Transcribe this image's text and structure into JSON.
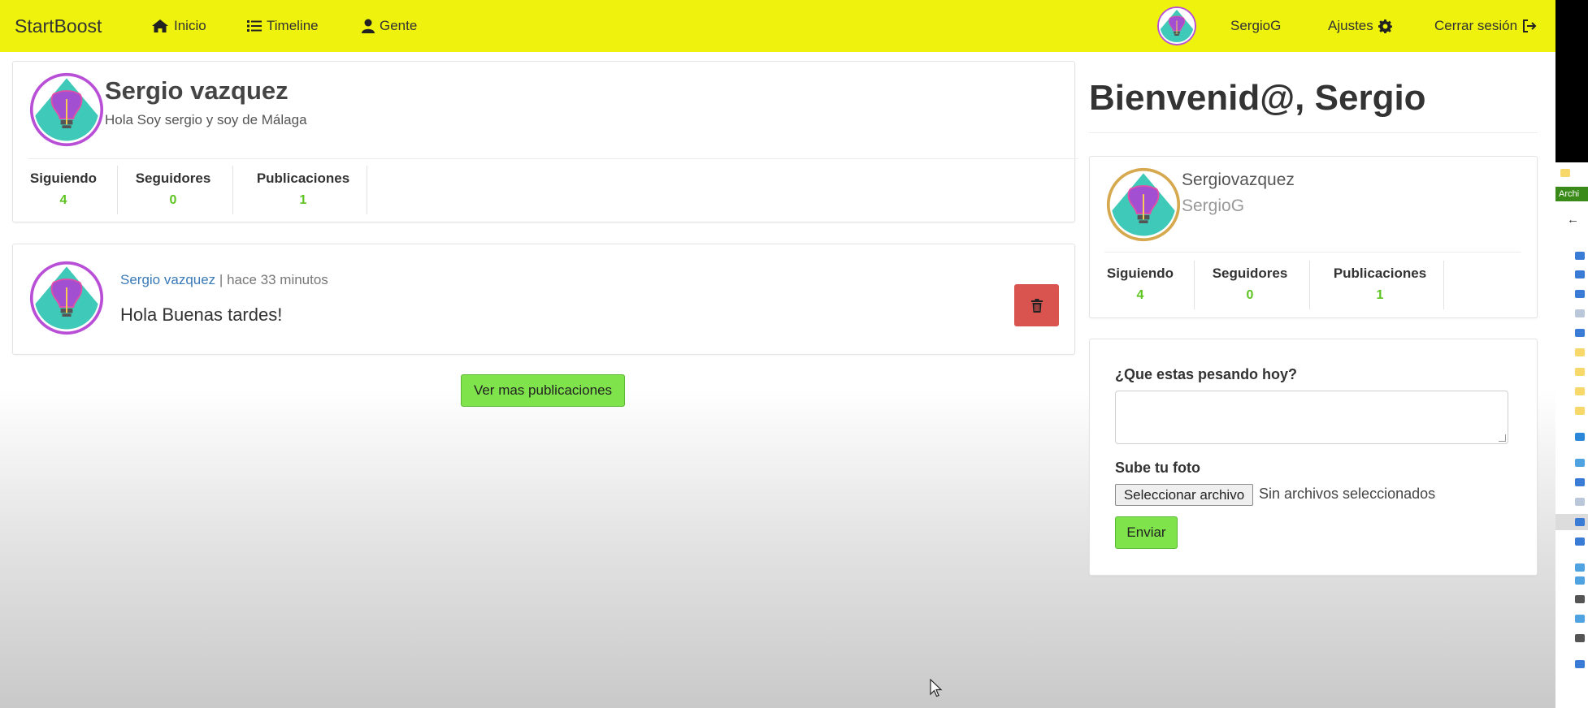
{
  "navbar": {
    "brand": "StartBoost",
    "items": [
      {
        "label": "Inicio",
        "icon": "home-icon"
      },
      {
        "label": "Timeline",
        "icon": "list-icon"
      },
      {
        "label": "Gente",
        "icon": "user-icon"
      }
    ],
    "username": "SergioG",
    "settings_label": "Ajustes",
    "logout_label": "Cerrar sesión",
    "background_color": "#eef20c"
  },
  "profile": {
    "name": "Sergio vazquez",
    "bio": "Hola Soy sergio y soy de Málaga",
    "stats": [
      {
        "label": "Siguiendo",
        "value": "4"
      },
      {
        "label": "Seguidores",
        "value": "0"
      },
      {
        "label": "Publicaciones",
        "value": "1"
      }
    ]
  },
  "post": {
    "author": "Sergio vazquez",
    "separator": " | ",
    "time": "hace 33 minutos",
    "text": "Hola Buenas tardes!"
  },
  "more_posts_label": "Ver mas publicaciones",
  "sidebar": {
    "welcome": "Bienvenid@, Sergio",
    "card": {
      "name": "Sergiovazquez",
      "nick": "SergioG",
      "stats": [
        {
          "label": "Siguiendo",
          "value": "4"
        },
        {
          "label": "Seguidores",
          "value": "0"
        },
        {
          "label": "Publicaciones",
          "value": "1"
        }
      ]
    },
    "form": {
      "question_label": "¿Que estas pesando hoy?",
      "textarea_value": "",
      "photo_label": "Sube tu foto",
      "file_button": "Seleccionar archivo",
      "file_status": "Sin archivos seleccionados",
      "submit_label": "Enviar"
    }
  },
  "side_window": {
    "tab_label": "Archi"
  },
  "colors": {
    "accent_green": "#7fe34b",
    "stat_green": "#5cc31f",
    "danger": "#d9534f",
    "link": "#3a7ab8"
  }
}
